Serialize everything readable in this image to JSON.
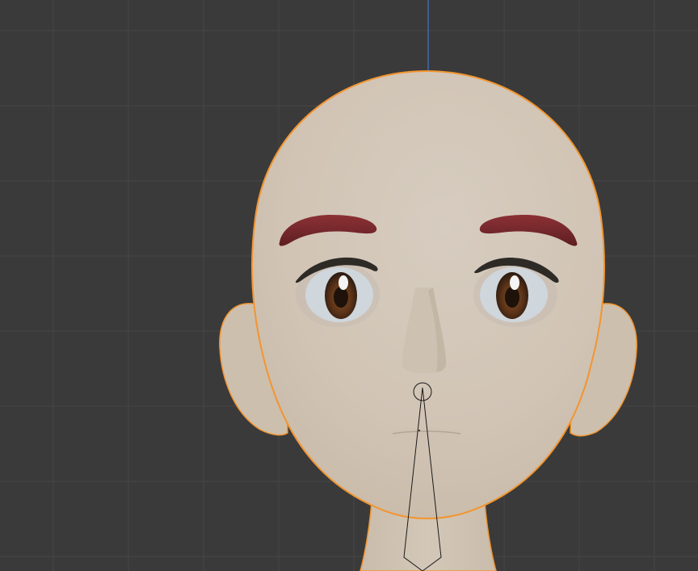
{
  "viewport": {
    "background_color": "#3a3a3a",
    "grid_color": "#444444",
    "z_axis_color": "#3f74d4",
    "selection_outline_color": "#f2952f",
    "skin_color": "#d2c6b8",
    "eyebrow_color": "#7a2a2c",
    "iris_color": "#5b3318",
    "lash_color": "#2e2b27",
    "bone_color": "#1a1a1a"
  },
  "scene": {
    "selected_object": "head-mesh",
    "shading": "rendered",
    "has_armature_bone": true
  }
}
